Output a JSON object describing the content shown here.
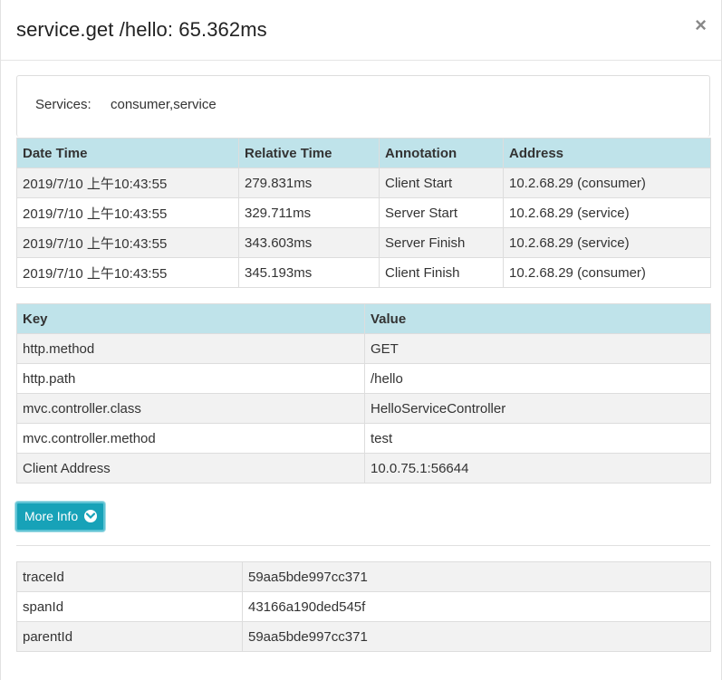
{
  "modal": {
    "title": "service.get /hello: 65.362ms",
    "close_label": "×"
  },
  "services": {
    "label": "Services:",
    "value": "consumer,service"
  },
  "annotations": {
    "headers": [
      "Date Time",
      "Relative Time",
      "Annotation",
      "Address"
    ],
    "rows": [
      [
        "2019/7/10 上午10:43:55",
        "279.831ms",
        "Client Start",
        "10.2.68.29 (consumer)"
      ],
      [
        "2019/7/10 上午10:43:55",
        "329.711ms",
        "Server Start",
        "10.2.68.29 (service)"
      ],
      [
        "2019/7/10 上午10:43:55",
        "343.603ms",
        "Server Finish",
        "10.2.68.29 (service)"
      ],
      [
        "2019/7/10 上午10:43:55",
        "345.193ms",
        "Client Finish",
        "10.2.68.29 (consumer)"
      ]
    ]
  },
  "tags": {
    "headers": [
      "Key",
      "Value"
    ],
    "rows": [
      [
        "http.method",
        "GET"
      ],
      [
        "http.path",
        "/hello"
      ],
      [
        "mvc.controller.class",
        "HelloServiceController"
      ],
      [
        "mvc.controller.method",
        "test"
      ],
      [
        "Client Address",
        "10.0.75.1:56644"
      ]
    ]
  },
  "more_info": {
    "label": "More Info",
    "icon": "chevron-circle-down-icon"
  },
  "ids": {
    "rows": [
      [
        "traceId",
        "59aa5bde997cc371"
      ],
      [
        "spanId",
        "43166a190ded545f"
      ],
      [
        "parentId",
        "59aa5bde997cc371"
      ]
    ]
  },
  "colors": {
    "header_bg": "#bfe3ea",
    "button_bg": "#17a2b8",
    "striped_row": "#f2f2f2"
  }
}
